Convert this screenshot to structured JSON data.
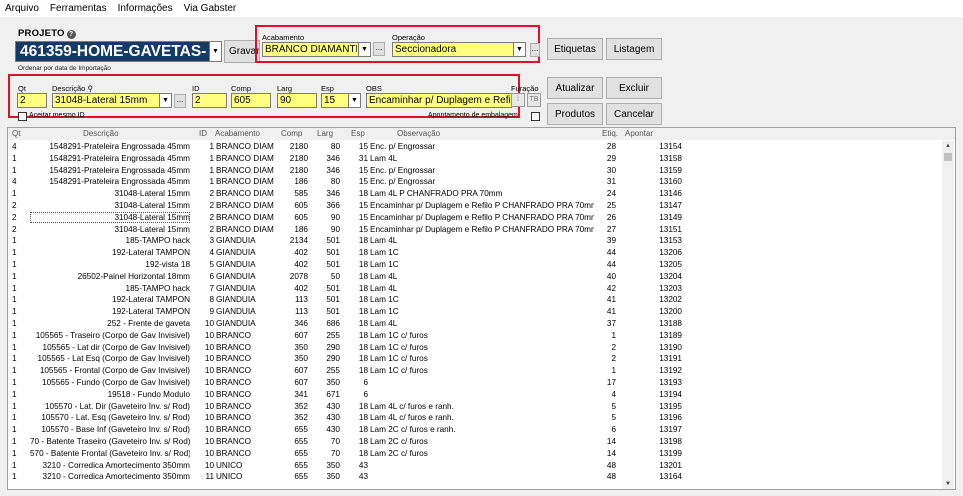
{
  "menu": [
    "Arquivo",
    "Ferramentas",
    "Informações",
    "Via Gabster"
  ],
  "projeto": {
    "label": "PROJETO",
    "value": "461359-HOME-GAVETAS-PI",
    "gravar": "Gravar",
    "ordenar": "Ordenar por data de Importação"
  },
  "acabamento": {
    "label": "Acabamento",
    "value": "BRANCO DIAMANTE ESS"
  },
  "operacao": {
    "label": "Operação",
    "value": "Seccionadora"
  },
  "buttons": {
    "etiquetas": "Etiquetas",
    "listagem": "Listagem",
    "atualizar": "Atualizar",
    "excluir": "Excluir",
    "produtos": "Produtos",
    "cancelar": "Cancelar",
    "dots": "..."
  },
  "form": {
    "qt_label": "Qt",
    "qt": "2",
    "descricao_label": "Descrição",
    "descricao": "31048-Lateral 15mm",
    "id_label": "ID",
    "id": "2",
    "comp_label": "Comp",
    "comp": "605",
    "larg_label": "Larg",
    "larg": "90",
    "esp_label": "Esp",
    "esp": "15",
    "obs_label": "OBS",
    "obs": "Encaminhar p/ Duplagem e Refilo P CH",
    "furacao_label": "Furação",
    "aceitar_label": "Aceitar mesmo ID",
    "apontamento_label": "Apontamento de embalagem"
  },
  "table": {
    "headers": [
      "Qt",
      "Descrição",
      "ID",
      "Acabamento",
      "Comp",
      "Larg",
      "Esp",
      "Observação",
      "Etiq.",
      "Apontar"
    ],
    "rows": [
      [
        "4",
        "1548291-Prateleira Engrossada 45mm",
        "1",
        "BRANCO DIAM",
        "2180",
        "80",
        "15",
        "Enc. p/ Engrossar",
        "28",
        "13154"
      ],
      [
        "1",
        "1548291-Prateleira Engrossada 45mm",
        "1",
        "BRANCO DIAM",
        "2180",
        "346",
        "31",
        "Lam 4L",
        "29",
        "13158"
      ],
      [
        "1",
        "1548291-Prateleira Engrossada 45mm",
        "1",
        "BRANCO DIAM",
        "2180",
        "346",
        "15",
        "Enc. p/ Engrossar",
        "30",
        "13159"
      ],
      [
        "4",
        "1548291-Prateleira Engrossada 45mm",
        "1",
        "BRANCO DIAM",
        "186",
        "80",
        "15",
        "Enc. p/ Engrossar",
        "31",
        "13160"
      ],
      [
        "1",
        "31048-Lateral 15mm",
        "2",
        "BRANCO DIAM",
        "585",
        "346",
        "18",
        "Lam 4L P CHANFRADO PRA 70mm",
        "24",
        "13146"
      ],
      [
        "2",
        "31048-Lateral 15mm",
        "2",
        "BRANCO DIAM",
        "605",
        "366",
        "15",
        "Encaminhar p/ Duplagem e Refilo P CHANFRADO PRA 70mm",
        "25",
        "13147"
      ],
      [
        "2",
        "31048-Lateral 15mm",
        "2",
        "BRANCO DIAM",
        "605",
        "90",
        "15",
        "Encaminhar p/ Duplagem e Refilo P CHANFRADO PRA 70mm",
        "26",
        "13149"
      ],
      [
        "2",
        "31048-Lateral 15mm",
        "2",
        "BRANCO DIAM",
        "186",
        "90",
        "15",
        "Encaminhar p/ Duplagem e Refilo P CHANFRADO PRA 70mm",
        "27",
        "13151"
      ],
      [
        "1",
        "185-TAMPO hack",
        "3",
        "GIANDUIA",
        "2134",
        "501",
        "18",
        "Lam 4L",
        "39",
        "13153"
      ],
      [
        "1",
        "192-Lateral TAMPON",
        "4",
        "GIANDUIA",
        "402",
        "501",
        "18",
        "Lam 1C",
        "44",
        "13206"
      ],
      [
        "1",
        "192-vista 18",
        "5",
        "GIANDUIA",
        "402",
        "501",
        "18",
        "Lam 1C",
        "44",
        "13205"
      ],
      [
        "1",
        "26502-Painel Horizontal 18mm",
        "6",
        "GIANDUIA",
        "2078",
        "50",
        "18",
        "Lam 4L",
        "40",
        "13204"
      ],
      [
        "1",
        "185-TAMPO hack",
        "7",
        "GIANDUIA",
        "402",
        "501",
        "18",
        "Lam 4L",
        "42",
        "13203"
      ],
      [
        "1",
        "192-Lateral TAMPON",
        "8",
        "GIANDUIA",
        "113",
        "501",
        "18",
        "Lam 1C",
        "41",
        "13202"
      ],
      [
        "1",
        "192-Lateral TAMPON",
        "9",
        "GIANDUIA",
        "113",
        "501",
        "18",
        "Lam 1C",
        "41",
        "13200"
      ],
      [
        "1",
        "252 - Frente de gaveta",
        "10",
        "GIANDUIA",
        "346",
        "686",
        "18",
        "Lam 4L",
        "37",
        "13188"
      ],
      [
        "1",
        "105565 - Traseiro (Corpo de Gav Invisivel)",
        "10",
        "BRANCO",
        "607",
        "255",
        "18",
        "Lam 1C c/ furos",
        "1",
        "13189"
      ],
      [
        "1",
        "105565 - Lat dir (Corpo de Gav Invisivel)",
        "10",
        "BRANCO",
        "350",
        "290",
        "18",
        "Lam 1C c/ furos",
        "2",
        "13190"
      ],
      [
        "1",
        "105565 - Lat Esq (Corpo de Gav Invisivel)",
        "10",
        "BRANCO",
        "350",
        "290",
        "18",
        "Lam 1C c/ furos",
        "2",
        "13191"
      ],
      [
        "1",
        "105565 - Frontal (Corpo de Gav Invisivel)",
        "10",
        "BRANCO",
        "607",
        "255",
        "18",
        "Lam 1C c/ furos",
        "1",
        "13192"
      ],
      [
        "1",
        "105565 - Fundo (Corpo de Gav Invisivel)",
        "10",
        "BRANCO",
        "607",
        "350",
        "6",
        "",
        "17",
        "13193"
      ],
      [
        "1",
        "19518 - Fundo Modulo",
        "10",
        "BRANCO",
        "341",
        "671",
        "6",
        "",
        "4",
        "13194"
      ],
      [
        "1",
        "105570 - Lat. Dir (Gaveteiro Inv. s/ Rod)",
        "10",
        "BRANCO",
        "352",
        "430",
        "18",
        "Lam 4L c/ furos e ranh.",
        "5",
        "13195"
      ],
      [
        "1",
        "105570 - Lat. Esq (Gaveteiro Inv. s/ Rod)",
        "10",
        "BRANCO",
        "352",
        "430",
        "18",
        "Lam 4L c/ furos e ranh.",
        "5",
        "13196"
      ],
      [
        "1",
        "105570 - Base Inf (Gaveteiro Inv. s/ Rod)",
        "10",
        "BRANCO",
        "655",
        "430",
        "18",
        "Lam 2C c/ furos e ranh.",
        "6",
        "13197"
      ],
      [
        "1",
        "70 - Batente Traseiro (Gaveteiro Inv. s/ Rod)",
        "10",
        "BRANCO",
        "655",
        "70",
        "18",
        "Lam 2C c/ furos",
        "14",
        "13198"
      ],
      [
        "1",
        "570 - Batente Frontal (Gaveteiro Inv. s/ Rod)",
        "10",
        "BRANCO",
        "655",
        "70",
        "18",
        "Lam 2C c/ furos",
        "14",
        "13199"
      ],
      [
        "1",
        "3210 - Corredica Amortecimento 350mm",
        "10",
        "UNICO",
        "655",
        "350",
        "43",
        "",
        "48",
        "13201"
      ],
      [
        "1",
        "3210 - Corredica Amortecimento 350mm",
        "11",
        "UNICO",
        "655",
        "350",
        "43",
        "",
        "48",
        "13164"
      ]
    ]
  },
  "colors": {
    "project_bg": "#153a63",
    "highlight_border": "#e0102a",
    "field_bg": "#ffff80"
  }
}
